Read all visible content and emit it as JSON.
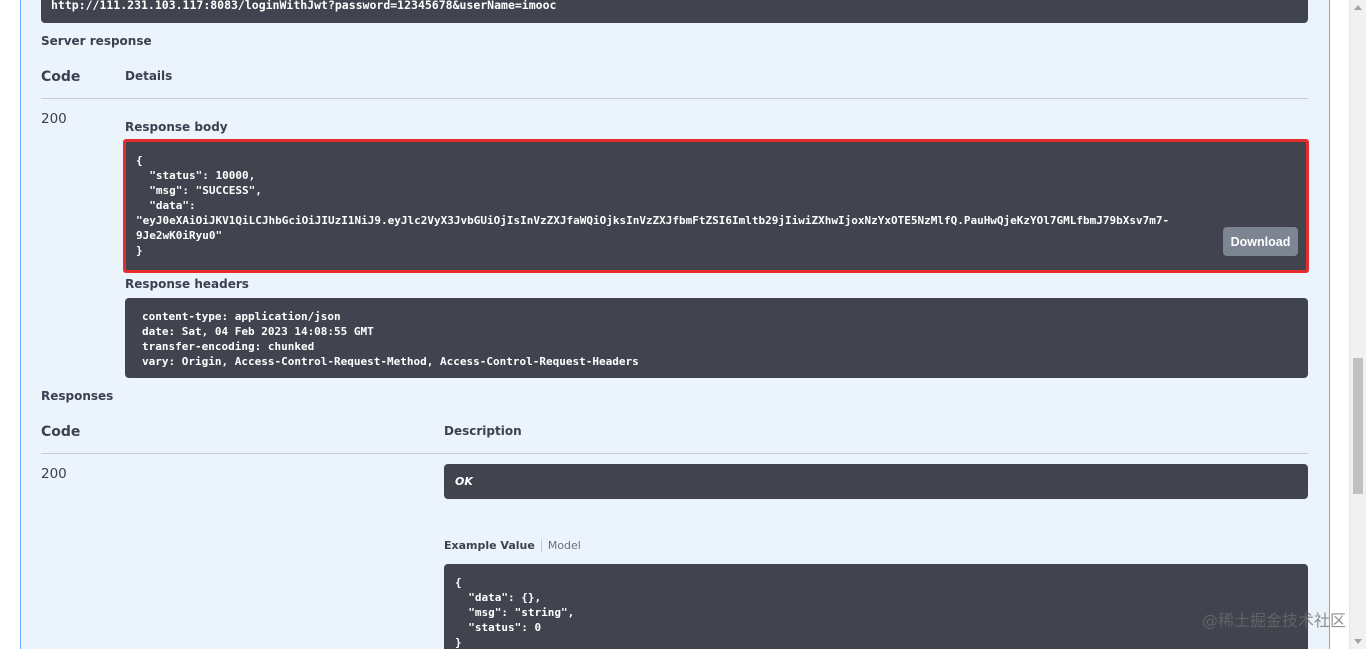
{
  "request_url": "http://111.231.103.117:8083/loginWithJwt?password=12345678&userName=imooc",
  "server_response": {
    "section_title": "Server response",
    "col_code": "Code",
    "col_details": "Details",
    "code": "200",
    "response_body_label": "Response body",
    "response_body": "{\n  \"status\": 10000,\n  \"msg\": \"SUCCESS\",\n  \"data\":\n\"eyJ0eXAiOiJKV1QiLCJhbGciOiJIUzI1NiJ9.eyJlc2VyX3JvbGUiOjIsInVzZXJfaWQiOjksInVzZXJfbmFtZSI6Imltb29jIiwiZXhwIjoxNzYxOTE5NzMlfQ.PauHwQjeKzYOl7GMLfbmJ79bXsv7m7-\n9Je2wK0iRyu0\"\n}",
    "download_label": "Download",
    "response_headers_label": "Response headers",
    "response_headers": "content-type: application/json\ndate: Sat, 04 Feb 2023 14:08:55 GMT\ntransfer-encoding: chunked\nvary: Origin, Access-Control-Request-Method, Access-Control-Request-Headers"
  },
  "responses": {
    "section_title": "Responses",
    "col_code": "Code",
    "col_description": "Description",
    "code": "200",
    "description": "OK",
    "example_value_tab": "Example Value",
    "model_tab": "Model",
    "example_value": "{\n  \"data\": {},\n  \"msg\": \"string\",\n  \"status\": 0\n}"
  },
  "watermark": "@稀土掘金技术社区",
  "colors": {
    "panel_bg": "#ebf3fb",
    "panel_border": "#61affe",
    "code_block_bg": "#41444e",
    "highlight_border": "#e52d2d",
    "download_button": "#7d8492"
  }
}
